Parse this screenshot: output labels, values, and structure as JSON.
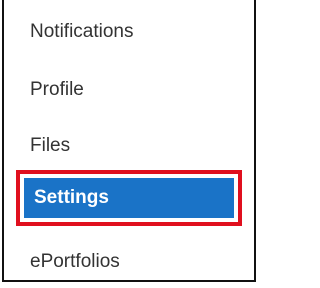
{
  "menu": {
    "items": [
      {
        "label": "Notifications"
      },
      {
        "label": "Profile"
      },
      {
        "label": "Files"
      },
      {
        "label": "Settings",
        "active": true
      },
      {
        "label": "ePortfolios"
      }
    ]
  },
  "colors": {
    "active_background": "#1a73c7",
    "active_text": "#ffffff",
    "highlight_border": "#e00f1e",
    "text": "#333333"
  }
}
